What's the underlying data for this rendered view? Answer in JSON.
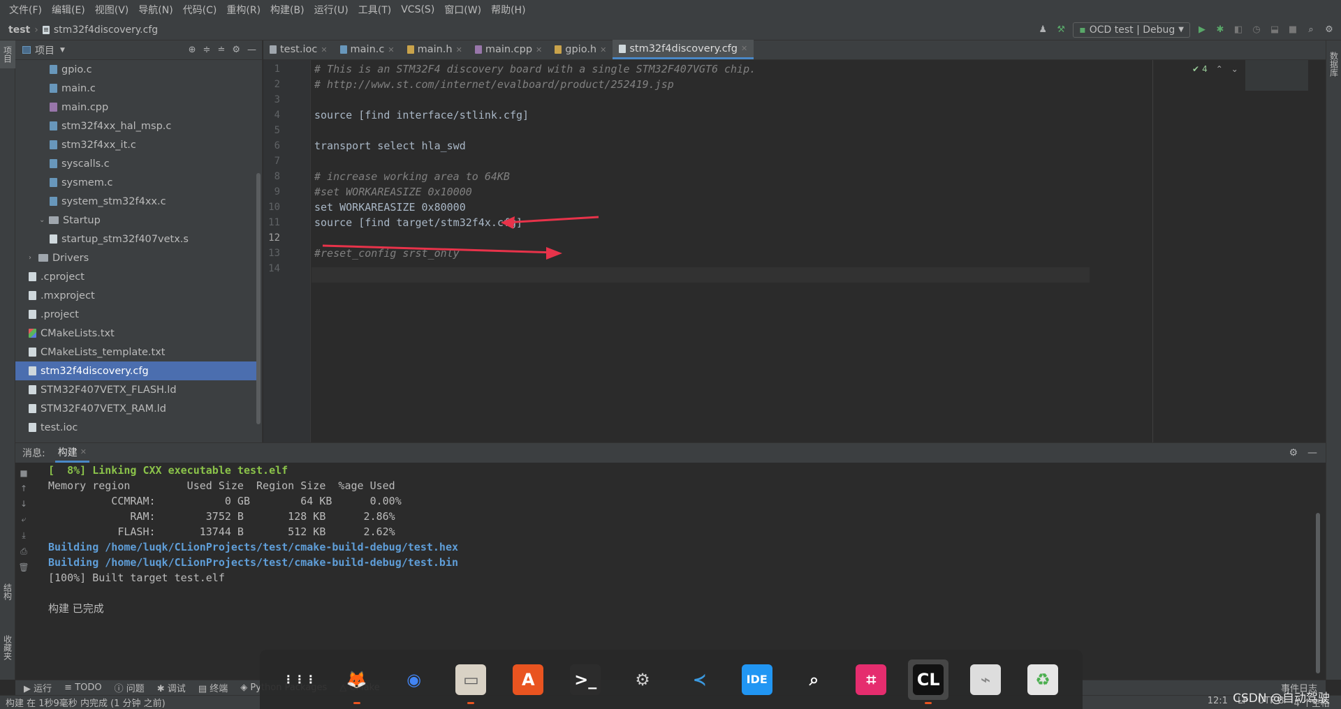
{
  "menu": [
    "文件(F)",
    "编辑(E)",
    "视图(V)",
    "导航(N)",
    "代码(C)",
    "重构(R)",
    "构建(B)",
    "运行(U)",
    "工具(T)",
    "VCS(S)",
    "窗口(W)",
    "帮助(H)"
  ],
  "breadcrumb": {
    "project": "test",
    "file": "stm32f4discovery.cfg"
  },
  "run_config": "OCD test | Debug",
  "left_strip": {
    "project_tab": "项目",
    "structure_tab": "结构",
    "favorites_tab": "收藏夹"
  },
  "right_strip": {
    "database_tab": "数据库"
  },
  "project_panel": {
    "title": "项目",
    "tree": [
      {
        "label": "gpio.c",
        "kind": "c",
        "indent": 3
      },
      {
        "label": "main.c",
        "kind": "c",
        "indent": 3
      },
      {
        "label": "main.cpp",
        "kind": "cpp",
        "indent": 3
      },
      {
        "label": "stm32f4xx_hal_msp.c",
        "kind": "c",
        "indent": 3
      },
      {
        "label": "stm32f4xx_it.c",
        "kind": "c",
        "indent": 3
      },
      {
        "label": "syscalls.c",
        "kind": "c",
        "indent": 3
      },
      {
        "label": "sysmem.c",
        "kind": "c",
        "indent": 3
      },
      {
        "label": "system_stm32f4xx.c",
        "kind": "c",
        "indent": 3
      },
      {
        "label": "Startup",
        "kind": "folder-open",
        "indent": 2
      },
      {
        "label": "startup_stm32f407vetx.s",
        "kind": "gen",
        "indent": 3
      },
      {
        "label": "Drivers",
        "kind": "folder-closed",
        "indent": 1
      },
      {
        "label": ".cproject",
        "kind": "gen",
        "indent": 1
      },
      {
        "label": ".mxproject",
        "kind": "gen",
        "indent": 1
      },
      {
        "label": ".project",
        "kind": "gen",
        "indent": 1
      },
      {
        "label": "CMakeLists.txt",
        "kind": "cmake",
        "indent": 1
      },
      {
        "label": "CMakeLists_template.txt",
        "kind": "gen",
        "indent": 1
      },
      {
        "label": "stm32f4discovery.cfg",
        "kind": "gen",
        "indent": 1,
        "selected": true
      },
      {
        "label": "STM32F407VETX_FLASH.ld",
        "kind": "gen",
        "indent": 1
      },
      {
        "label": "STM32F407VETX_RAM.ld",
        "kind": "gen",
        "indent": 1
      },
      {
        "label": "test.ioc",
        "kind": "gen",
        "indent": 1
      }
    ]
  },
  "editor_tabs": [
    {
      "label": "test.ioc",
      "color": "#9fa6ad"
    },
    {
      "label": "main.c",
      "color": "#6897bb"
    },
    {
      "label": "main.h",
      "color": "#c9a34b"
    },
    {
      "label": "main.cpp",
      "color": "#9876aa"
    },
    {
      "label": "gpio.h",
      "color": "#c9a34b"
    },
    {
      "label": "stm32f4discovery.cfg",
      "color": "#cfd8dc",
      "active": true
    }
  ],
  "inspections": {
    "count": "4"
  },
  "code_lines": [
    {
      "n": "1",
      "text": "# This is an STM32F4 discovery board with a single STM32F407VGT6 chip.",
      "comment": true
    },
    {
      "n": "2",
      "text": "# http://www.st.com/internet/evalboard/product/252419.jsp",
      "comment": true
    },
    {
      "n": "3",
      "text": "",
      "comment": false
    },
    {
      "n": "4",
      "text": "source [find interface/stlink.cfg]",
      "comment": false
    },
    {
      "n": "5",
      "text": "",
      "comment": false
    },
    {
      "n": "6",
      "text": "transport select hla_swd",
      "comment": false
    },
    {
      "n": "7",
      "text": "",
      "comment": false
    },
    {
      "n": "8",
      "text": "# increase working area to 64KB",
      "comment": true
    },
    {
      "n": "9",
      "text": "#set WORKAREASIZE 0x10000",
      "comment": true
    },
    {
      "n": "10",
      "text": "set WORKAREASIZE 0x80000",
      "comment": false
    },
    {
      "n": "11",
      "text": "source [find target/stm32f4x.cfg]",
      "comment": false
    },
    {
      "n": "12",
      "text": "",
      "comment": false
    },
    {
      "n": "13",
      "text": "#reset_config srst_only",
      "comment": true
    },
    {
      "n": "14",
      "text": "",
      "comment": false
    }
  ],
  "build": {
    "header": "消息:",
    "tab": "构建",
    "output": [
      {
        "text": "[  8%] Linking CXX executable test.elf",
        "style": "green"
      },
      {
        "text": "Memory region         Used Size  Region Size  %age Used",
        "style": ""
      },
      {
        "text": "          CCMRAM:           0 GB        64 KB      0.00%",
        "style": ""
      },
      {
        "text": "             RAM:        3752 B       128 KB      2.86%",
        "style": ""
      },
      {
        "text": "           FLASH:       13744 B       512 KB      2.62%",
        "style": ""
      },
      {
        "text": "Building /home/luqk/CLionProjects/test/cmake-build-debug/test.hex",
        "style": "blue"
      },
      {
        "text": "Building /home/luqk/CLionProjects/test/cmake-build-debug/test.bin",
        "style": "blue"
      },
      {
        "text": "[100%] Built target test.elf",
        "style": ""
      },
      {
        "text": "",
        "style": ""
      },
      {
        "text": "构建 已完成",
        "style": "plain"
      }
    ]
  },
  "tool_tabs": [
    "运行",
    "TODO",
    "问题",
    "调试",
    "终端",
    "Python Packages",
    "CMake"
  ],
  "status": {
    "left": "构建 在 1秒9毫秒 内完成 (1 分钟 之前)",
    "position": "12:1",
    "line_sep": "LF",
    "encoding": "UTF-8",
    "indent": "4 个空格",
    "event_log": "事件日志"
  },
  "dock": [
    "apps-grid-icon",
    "firefox-icon",
    "chrome-icon",
    "files-icon",
    "software-icon",
    "terminal-icon",
    "settings-icon",
    "vscode-icon",
    "ide-icon",
    "search-icon",
    "screenshot-icon",
    "clion-icon",
    "usb-icon",
    "trash-icon"
  ],
  "watermark": "CSDN @自动驾驶"
}
